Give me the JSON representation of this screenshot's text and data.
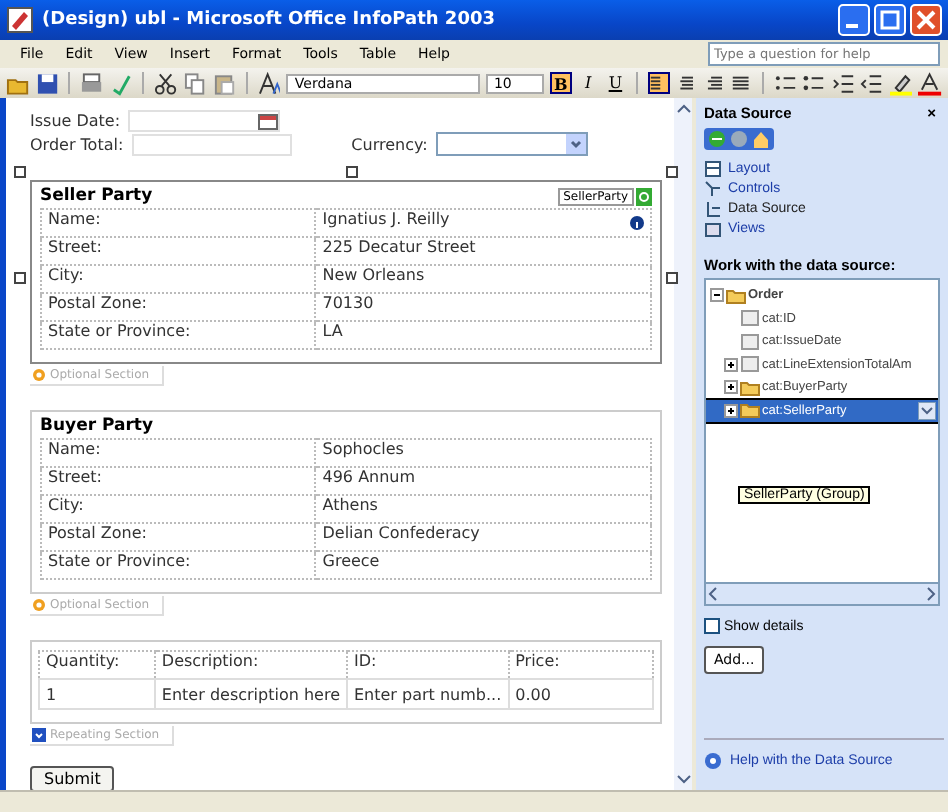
{
  "window": {
    "title": "(Design) ubl - Microsoft Office InfoPath 2003"
  },
  "menu": [
    "File",
    "Edit",
    "View",
    "Insert",
    "Format",
    "Tools",
    "Table",
    "Help"
  ],
  "help_box": {
    "placeholder": "Type a question for help"
  },
  "toolbar": {
    "font": "Verdana",
    "size": "10",
    "format_buttons": [
      {
        "label": "B",
        "kind": "bold",
        "on": true
      },
      {
        "label": "I",
        "kind": "italic",
        "on": false
      },
      {
        "label": "U",
        "kind": "underline",
        "on": false
      }
    ],
    "align_buttons": [
      {
        "kind": "left",
        "on": true
      },
      {
        "kind": "center",
        "on": false
      },
      {
        "kind": "right",
        "on": false
      },
      {
        "kind": "justify",
        "on": false
      }
    ]
  },
  "form": {
    "issue_date": {
      "label": "Issue Date:"
    },
    "order_total": {
      "label": "Order Total:"
    },
    "currency": {
      "label": "Currency:"
    },
    "sections": [
      {
        "title": "Seller Party",
        "tag": "SellerParty",
        "selected": true,
        "section_label": "Optional Section",
        "rows": [
          {
            "label": "Name:",
            "value": "Ignatius J. Reilly"
          },
          {
            "label": "Street:",
            "value": "225 Decatur Street"
          },
          {
            "label": "City:",
            "value": "New Orleans"
          },
          {
            "label": "Postal Zone:",
            "value": "70130"
          },
          {
            "label": "State or Province:",
            "value": "LA"
          }
        ]
      },
      {
        "title": "Buyer Party",
        "selected": false,
        "section_label": "Optional Section",
        "rows": [
          {
            "label": "Name:",
            "value": "Sophocles"
          },
          {
            "label": "Street:",
            "value": "496 Annum"
          },
          {
            "label": "City:",
            "value": "Athens"
          },
          {
            "label": "Postal Zone:",
            "value": "Delian Confederacy"
          },
          {
            "label": "State or Province:",
            "value": "Greece"
          }
        ]
      }
    ],
    "line_items": {
      "columns": [
        "Quantity:",
        "Description:",
        "ID:",
        "Price:"
      ],
      "rows": [
        [
          "1",
          "Enter description here",
          "Enter part numb...",
          "0.00"
        ]
      ],
      "section_label": "Repeating Section"
    },
    "submit": "Submit"
  },
  "task_pane": {
    "title": "Data Source",
    "close": "×",
    "links": [
      {
        "label": "Layout",
        "selected": false
      },
      {
        "label": "Controls",
        "selected": false
      },
      {
        "label": "Data Source",
        "selected": true
      },
      {
        "label": "Views",
        "selected": false
      }
    ],
    "heading": "Work with the data source:",
    "tree": [
      {
        "label": "Order",
        "kind": "folder",
        "expanded": true,
        "selected": false,
        "children": [
          {
            "label": "cat:ID",
            "kind": "field",
            "selected": false
          },
          {
            "label": "cat:IssueDate",
            "kind": "field",
            "selected": false
          },
          {
            "label": "cat:LineExtensionTotalAm",
            "kind": "field",
            "expanded": false,
            "selected": false
          },
          {
            "label": "cat:BuyerParty",
            "kind": "folder",
            "expanded": false,
            "selected": false
          },
          {
            "label": "cat:SellerParty",
            "kind": "folder",
            "expanded": false,
            "selected": true
          }
        ]
      }
    ],
    "tooltip": "SellerParty (Group)",
    "show_details": {
      "label": "Show details",
      "checked": false
    },
    "add_button": "Add...",
    "help_link": "Help with the Data Source"
  }
}
